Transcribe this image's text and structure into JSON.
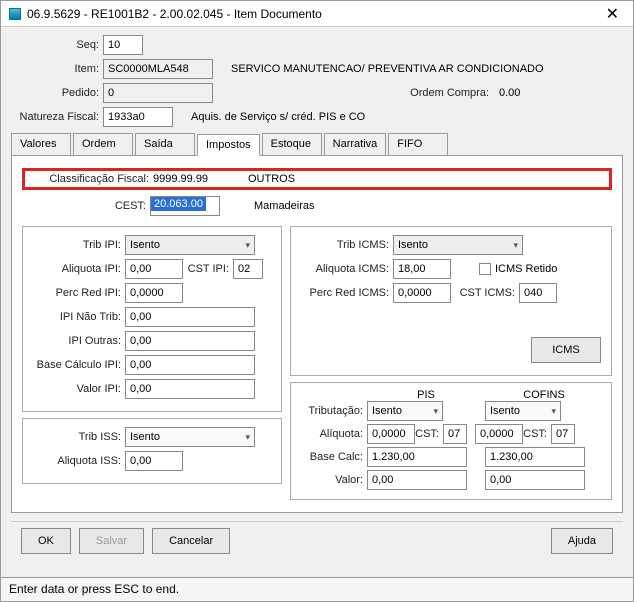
{
  "window": {
    "title": "06.9.5629 - RE1001B2 - 2.00.02.045 - Item Documento"
  },
  "header": {
    "seq_label": "Seq:",
    "seq": "10",
    "item_label": "Item:",
    "item": "SC0000MLA548",
    "item_desc": "SERVICO MANUTENCAO/ PREVENTIVA AR CONDICIONADO",
    "pedido_label": "Pedido:",
    "pedido": "0",
    "ordem_compra_label": "Ordem Compra:",
    "ordem_compra": "0.00",
    "nat_fiscal_label": "Natureza Fiscal:",
    "nat_fiscal": "1933a0",
    "nat_fiscal_desc": "Aquis. de Serviço s/ créd. PIS e CO"
  },
  "tabs": [
    "Valores",
    "Ordem",
    "Saída",
    "Impostos",
    "Estoque",
    "Narrativa",
    "FIFO"
  ],
  "impostos": {
    "classif_label": "Classificação Fiscal:",
    "classif": "9999.99.99",
    "classif_desc": "OUTROS",
    "cest_label": "CEST:",
    "cest": "20.063.00",
    "cest_desc": "Mamadeiras",
    "ipi": {
      "trib_label": "Trib IPI:",
      "trib": "Isento",
      "aliq_label": "Aliquota IPI:",
      "aliq": "0,00",
      "cst_label": "CST IPI:",
      "cst": "02",
      "perc_red_label": "Perc Red IPI:",
      "perc_red": "0,0000",
      "nao_trib_label": "IPI Não Trib:",
      "nao_trib": "0,00",
      "outras_label": "IPI Outras:",
      "outras": "0,00",
      "base_label": "Base Cálculo IPI:",
      "base": "0,00",
      "valor_label": "Valor IPI:",
      "valor": "0,00"
    },
    "icms": {
      "trib_label": "Trib ICMS:",
      "trib": "Isento",
      "aliq_label": "Aliquota ICMS:",
      "aliq": "18,00",
      "retido_label": "ICMS Retido",
      "perc_red_label": "Perc Red ICMS:",
      "perc_red": "0,0000",
      "cst_label": "CST ICMS:",
      "cst": "040",
      "btn": "ICMS"
    },
    "iss": {
      "trib_label": "Trib ISS:",
      "trib": "Isento",
      "aliq_label": "Aliquota ISS:",
      "aliq": "0,00"
    },
    "piscofins": {
      "pis_header": "PIS",
      "cofins_header": "COFINS",
      "trib_label": "Tributação:",
      "pis_trib": "Isento",
      "cofins_trib": "Isento",
      "aliq_label": "Alíquota:",
      "pis_aliq": "0,0000",
      "pis_cst_lbl": "CST:",
      "pis_cst": "07",
      "cofins_aliq": "0,0000",
      "cofins_cst_lbl": "CST:",
      "cofins_cst": "07",
      "base_label": "Base Calc:",
      "pis_base": "1.230,00",
      "cofins_base": "1.230,00",
      "valor_label": "Valor:",
      "pis_valor": "0,00",
      "cofins_valor": "0,00"
    }
  },
  "buttons": {
    "ok": "OK",
    "salvar": "Salvar",
    "cancelar": "Cancelar",
    "ajuda": "Ajuda"
  },
  "status": "Enter data or press ESC to end."
}
